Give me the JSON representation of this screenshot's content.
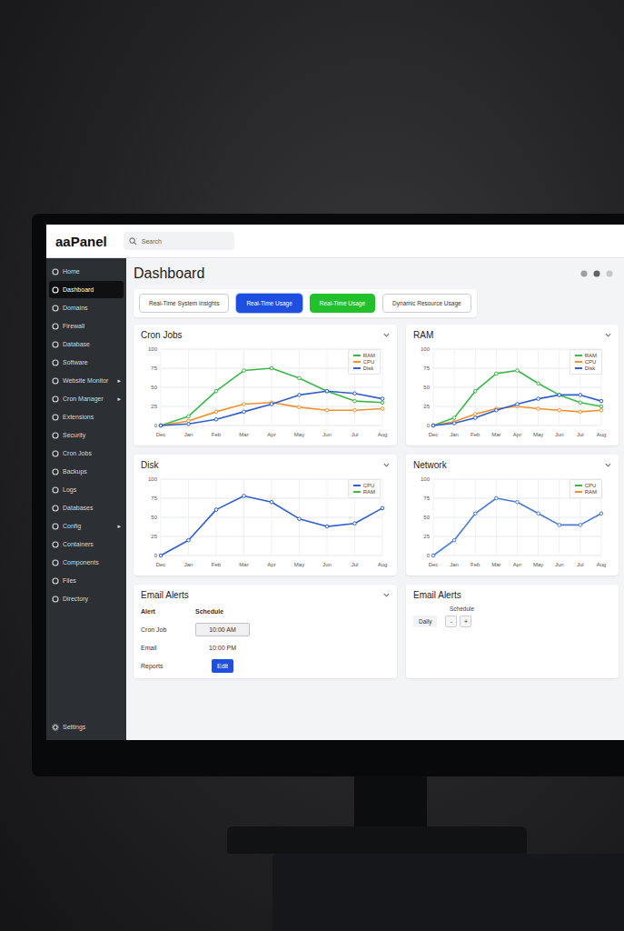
{
  "page": {
    "title": "Dashboard"
  },
  "header": {
    "logo": "aaPanel",
    "search_placeholder": "Search"
  },
  "sidebar": {
    "items": [
      {
        "label": "Home",
        "selected": false,
        "arrow": ""
      },
      {
        "label": "Dashboard",
        "selected": true,
        "arrow": ""
      },
      {
        "label": "Domains",
        "selected": false,
        "arrow": ""
      },
      {
        "label": "Firewall",
        "selected": false,
        "arrow": ""
      },
      {
        "label": "Database",
        "selected": false,
        "arrow": ""
      },
      {
        "label": "Software",
        "selected": false,
        "arrow": ""
      },
      {
        "label": "Website Monitor",
        "selected": false,
        "arrow": "▸"
      },
      {
        "label": "Cron Manager",
        "selected": false,
        "arrow": "▸"
      },
      {
        "label": "Extensions",
        "selected": false,
        "arrow": ""
      },
      {
        "label": "Security",
        "selected": false,
        "arrow": ""
      },
      {
        "label": "Cron Jobs",
        "selected": false,
        "arrow": ""
      },
      {
        "label": "Backups",
        "selected": false,
        "arrow": ""
      },
      {
        "label": "Logs",
        "selected": false,
        "arrow": ""
      },
      {
        "label": "Databases",
        "selected": false,
        "arrow": ""
      },
      {
        "label": "Config",
        "selected": false,
        "arrow": "▸"
      },
      {
        "label": "Containers",
        "selected": false,
        "arrow": ""
      },
      {
        "label": "Components",
        "selected": false,
        "arrow": ""
      },
      {
        "label": "Files",
        "selected": false,
        "arrow": ""
      },
      {
        "label": "Directory",
        "selected": false,
        "arrow": ""
      }
    ],
    "footer": "Settings"
  },
  "tabs": [
    {
      "label": "Real-Time System Insights",
      "selected": false,
      "kind": "outline",
      "color": "#ffffff"
    },
    {
      "label": "Real-Time Usage",
      "selected": true,
      "kind": "filled",
      "color": "#1f4fe0"
    },
    {
      "label": "Real-Time Usage",
      "selected": false,
      "kind": "filled",
      "color": "#22c02a"
    },
    {
      "label": "Dynamic Resource Usage",
      "selected": false,
      "kind": "outline",
      "color": "#ffffff"
    }
  ],
  "charts": [
    {
      "title": "Cron Jobs",
      "y_ticks": [
        "100",
        "75",
        "50",
        "25",
        "0"
      ],
      "y_max": 100,
      "x_labels": [
        "Dec",
        "Jan",
        "Feb",
        "Mar",
        "Apr",
        "May",
        "Jun",
        "Jul",
        "Aug"
      ],
      "legend": [
        {
          "label": "RAM",
          "color": "#3cb84a"
        },
        {
          "label": "CPU",
          "color": "#f0922e"
        },
        {
          "label": "Disk",
          "color": "#2f5fd0"
        }
      ],
      "series": [
        {
          "name": "RAM",
          "color": "#3cb84a",
          "values": [
            0,
            12,
            45,
            72,
            75,
            62,
            45,
            32,
            30
          ]
        },
        {
          "name": "CPU",
          "color": "#f0922e",
          "values": [
            0,
            6,
            18,
            28,
            30,
            24,
            20,
            20,
            22
          ]
        },
        {
          "name": "Disk",
          "color": "#2f5fd0",
          "values": [
            0,
            2,
            8,
            18,
            28,
            40,
            45,
            42,
            35
          ]
        }
      ]
    },
    {
      "title": "RAM",
      "y_ticks": [
        "100",
        "75",
        "50",
        "25",
        "0"
      ],
      "y_max": 100,
      "x_labels": [
        "Dec",
        "Jan",
        "Feb",
        "Mar",
        "Apr",
        "May",
        "Jun",
        "Jul",
        "Aug"
      ],
      "legend": [
        {
          "label": "RAM",
          "color": "#3cb84a"
        },
        {
          "label": "CPU",
          "color": "#f0922e"
        },
        {
          "label": "Disk",
          "color": "#2f5fd0"
        }
      ],
      "series": [
        {
          "name": "RAM",
          "color": "#3cb84a",
          "values": [
            0,
            10,
            45,
            68,
            72,
            55,
            40,
            30,
            25
          ]
        },
        {
          "name": "CPU",
          "color": "#f0922e",
          "values": [
            0,
            5,
            15,
            22,
            25,
            22,
            20,
            18,
            20
          ]
        },
        {
          "name": "Disk",
          "color": "#2f5fd0",
          "values": [
            0,
            3,
            10,
            20,
            28,
            35,
            40,
            40,
            32
          ]
        }
      ]
    },
    {
      "title": "Disk",
      "y_ticks": [
        "100",
        "75",
        "50",
        "25",
        "0"
      ],
      "y_max": 100,
      "x_labels": [
        "Dec",
        "Jan",
        "Feb",
        "Mar",
        "Apr",
        "May",
        "Jun",
        "Jul",
        "Aug"
      ],
      "legend": [
        {
          "label": "CPU",
          "color": "#2f5fd0"
        },
        {
          "label": "RAM",
          "color": "#3cb84a"
        }
      ],
      "series": [
        {
          "name": "Disk",
          "color": "#2f5fd0",
          "values": [
            0,
            20,
            60,
            78,
            70,
            48,
            38,
            42,
            62
          ]
        }
      ]
    },
    {
      "title": "Network",
      "y_ticks": [
        "100",
        "75",
        "50",
        "25",
        "0"
      ],
      "y_max": 100,
      "x_labels": [
        "Dec",
        "Jan",
        "Feb",
        "Mar",
        "Apr",
        "May",
        "Jun",
        "Jul",
        "Aug"
      ],
      "legend": [
        {
          "label": "CPU",
          "color": "#3cb84a"
        },
        {
          "label": "RAM",
          "color": "#f0922e"
        }
      ],
      "series": [
        {
          "name": "Network",
          "color": "#4a7bd6",
          "values": [
            0,
            20,
            55,
            75,
            70,
            55,
            40,
            40,
            55
          ]
        }
      ]
    }
  ],
  "email_alerts": {
    "title": "Email Alerts",
    "columns": [
      "Alert",
      "Schedule"
    ],
    "rows": [
      {
        "name": "Cron Job",
        "value": "10:00 AM",
        "kind": "field"
      },
      {
        "name": "Email",
        "value": "10:00 PM",
        "kind": "text"
      },
      {
        "name": "Reports",
        "value": "Edit",
        "kind": "button"
      }
    ]
  },
  "email_schedule": {
    "title": "Email Alerts",
    "label": "Schedule",
    "field": "Daily",
    "buttons": [
      "-",
      "+"
    ]
  }
}
